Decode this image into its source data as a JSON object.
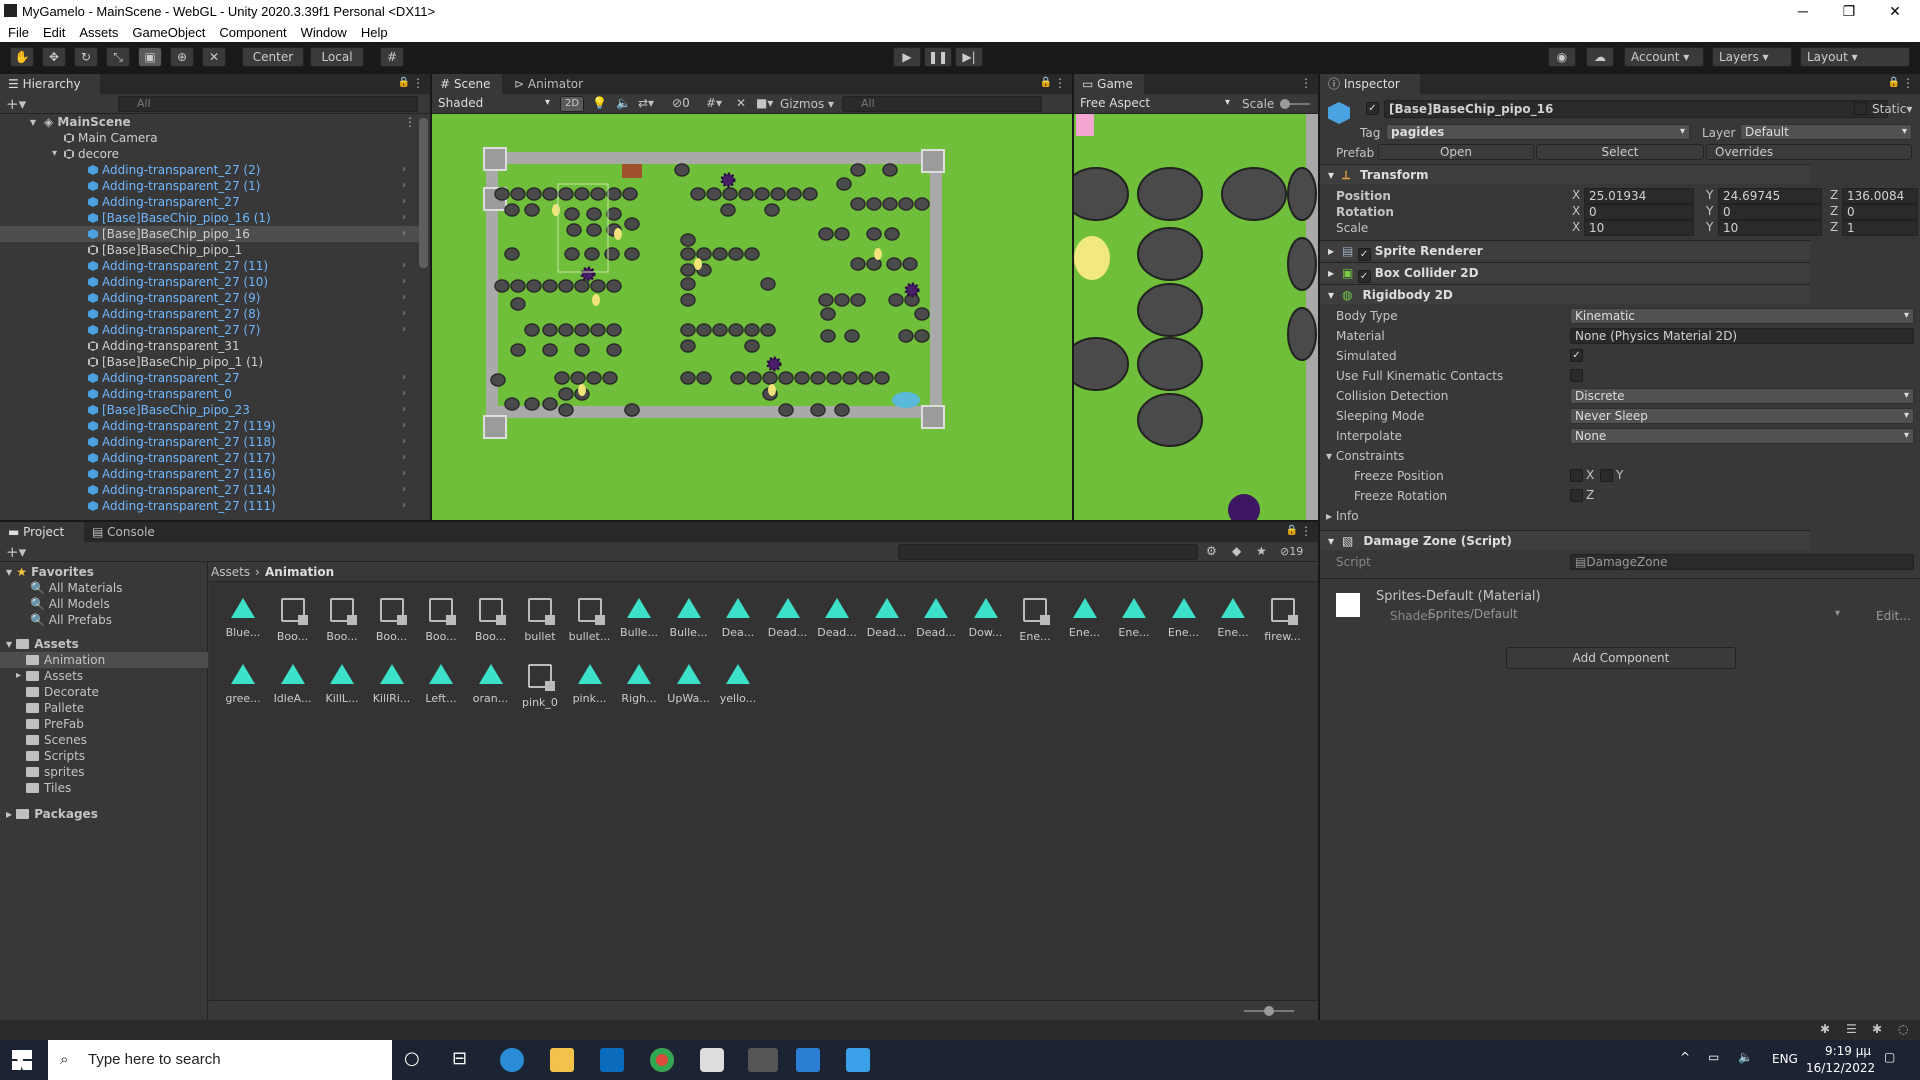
{
  "window": {
    "title": "MyGamelo - MainScene - WebGL - Unity 2020.3.39f1 Personal <DX11>",
    "min": "─",
    "max": "❐",
    "close": "✕"
  },
  "menu": [
    "File",
    "Edit",
    "Assets",
    "GameObject",
    "Component",
    "Window",
    "Help"
  ],
  "toolbar": {
    "pivot": "Center",
    "space": "Local",
    "account": "Account",
    "layers": "Layers",
    "layout": "Layout"
  },
  "hierarchy": {
    "tab": "Hierarchy",
    "search_placeholder": "All",
    "rows": [
      {
        "label": "MainScene",
        "icon": "scene",
        "indent": 0,
        "blue": false,
        "sel": false,
        "arrow": false
      },
      {
        "label": "Main Camera",
        "icon": "grey",
        "indent": 1,
        "blue": false,
        "sel": false,
        "arrow": false
      },
      {
        "label": "decore",
        "icon": "grey",
        "indent": 1,
        "blue": false,
        "sel": false,
        "arrow": false
      },
      {
        "label": "Adding-transparent_27 (2)",
        "icon": "blue",
        "indent": 2,
        "blue": true,
        "sel": false,
        "arrow": true
      },
      {
        "label": "Adding-transparent_27 (1)",
        "icon": "blue",
        "indent": 2,
        "blue": true,
        "sel": false,
        "arrow": true
      },
      {
        "label": "Adding-transparent_27",
        "icon": "blue",
        "indent": 2,
        "blue": true,
        "sel": false,
        "arrow": true
      },
      {
        "label": "[Base]BaseChip_pipo_16 (1)",
        "icon": "blue",
        "indent": 2,
        "blue": true,
        "sel": false,
        "arrow": true
      },
      {
        "label": "[Base]BaseChip_pipo_16",
        "icon": "blue",
        "indent": 2,
        "blue": false,
        "sel": true,
        "arrow": true
      },
      {
        "label": "[Base]BaseChip_pipo_1",
        "icon": "grey",
        "indent": 2,
        "blue": false,
        "sel": false,
        "arrow": false
      },
      {
        "label": "Adding-transparent_27 (11)",
        "icon": "blue",
        "indent": 2,
        "blue": true,
        "sel": false,
        "arrow": true
      },
      {
        "label": "Adding-transparent_27 (10)",
        "icon": "blue",
        "indent": 2,
        "blue": true,
        "sel": false,
        "arrow": true
      },
      {
        "label": "Adding-transparent_27 (9)",
        "icon": "blue",
        "indent": 2,
        "blue": true,
        "sel": false,
        "arrow": true
      },
      {
        "label": "Adding-transparent_27 (8)",
        "icon": "blue",
        "indent": 2,
        "blue": true,
        "sel": false,
        "arrow": true
      },
      {
        "label": "Adding-transparent_27 (7)",
        "icon": "blue",
        "indent": 2,
        "blue": true,
        "sel": false,
        "arrow": true
      },
      {
        "label": "Adding-transparent_31",
        "icon": "grey",
        "indent": 2,
        "blue": false,
        "sel": false,
        "arrow": false
      },
      {
        "label": "[Base]BaseChip_pipo_1 (1)",
        "icon": "grey",
        "indent": 2,
        "blue": false,
        "sel": false,
        "arrow": false
      },
      {
        "label": "Adding-transparent_27",
        "icon": "blue",
        "indent": 2,
        "blue": true,
        "sel": false,
        "arrow": true
      },
      {
        "label": "Adding-transparent_0",
        "icon": "blue",
        "indent": 2,
        "blue": true,
        "sel": false,
        "arrow": true
      },
      {
        "label": "[Base]BaseChip_pipo_23",
        "icon": "blue",
        "indent": 2,
        "blue": true,
        "sel": false,
        "arrow": true
      },
      {
        "label": "Adding-transparent_27 (119)",
        "icon": "blue",
        "indent": 2,
        "blue": true,
        "sel": false,
        "arrow": true
      },
      {
        "label": "Adding-transparent_27 (118)",
        "icon": "blue",
        "indent": 2,
        "blue": true,
        "sel": false,
        "arrow": true
      },
      {
        "label": "Adding-transparent_27 (117)",
        "icon": "blue",
        "indent": 2,
        "blue": true,
        "sel": false,
        "arrow": true
      },
      {
        "label": "Adding-transparent_27 (116)",
        "icon": "blue",
        "indent": 2,
        "blue": true,
        "sel": false,
        "arrow": true
      },
      {
        "label": "Adding-transparent_27 (114)",
        "icon": "blue",
        "indent": 2,
        "blue": true,
        "sel": false,
        "arrow": true
      },
      {
        "label": "Adding-transparent_27 (111)",
        "icon": "blue",
        "indent": 2,
        "blue": true,
        "sel": false,
        "arrow": true
      }
    ]
  },
  "scene": {
    "tab_scene": "Scene",
    "tab_animator": "Animator",
    "shading": "Shaded",
    "mode2d": "2D",
    "hidden_count": "0",
    "gizmos": "Gizmos",
    "search_placeholder": "All"
  },
  "game": {
    "tab": "Game",
    "aspect": "Free Aspect",
    "scale_label": "Scale"
  },
  "project": {
    "tab_project": "Project",
    "tab_console": "Console",
    "badge": "19",
    "breadcrumb": [
      "Assets",
      "Animation"
    ],
    "favorites": {
      "label": "Favorites",
      "items": [
        "All Materials",
        "All Models",
        "All Prefabs"
      ]
    },
    "assets_root": "Assets",
    "folders": [
      "Animation",
      "Assets",
      "Decorate",
      "Pallete",
      "PreFab",
      "Scenes",
      "Scripts",
      "sprites",
      "Tiles"
    ],
    "packages": "Packages",
    "row1": [
      {
        "label": "Blue...",
        "kind": "anim"
      },
      {
        "label": "Boo...",
        "kind": "ctrl"
      },
      {
        "label": "Boo...",
        "kind": "ctrl"
      },
      {
        "label": "Boo...",
        "kind": "ctrl"
      },
      {
        "label": "Boo...",
        "kind": "ctrl"
      },
      {
        "label": "Boo...",
        "kind": "ctrl"
      },
      {
        "label": "bullet",
        "kind": "ctrl"
      },
      {
        "label": "bullet...",
        "kind": "ctrl"
      },
      {
        "label": "Bulle...",
        "kind": "anim"
      },
      {
        "label": "Bulle...",
        "kind": "anim"
      },
      {
        "label": "Dea...",
        "kind": "anim"
      },
      {
        "label": "Dead...",
        "kind": "anim"
      },
      {
        "label": "Dead...",
        "kind": "anim"
      },
      {
        "label": "Dead...",
        "kind": "anim"
      },
      {
        "label": "Dead...",
        "kind": "anim"
      },
      {
        "label": "Dow...",
        "kind": "anim"
      },
      {
        "label": "Ene...",
        "kind": "ctrl"
      },
      {
        "label": "Ene...",
        "kind": "anim"
      },
      {
        "label": "Ene...",
        "kind": "anim"
      },
      {
        "label": "Ene...",
        "kind": "anim"
      },
      {
        "label": "Ene...",
        "kind": "anim"
      },
      {
        "label": "firew...",
        "kind": "ctrl"
      }
    ],
    "row2": [
      {
        "label": "gree...",
        "kind": "anim"
      },
      {
        "label": "IdleA...",
        "kind": "anim"
      },
      {
        "label": "KillL...",
        "kind": "anim"
      },
      {
        "label": "KillRi...",
        "kind": "anim"
      },
      {
        "label": "Left...",
        "kind": "anim"
      },
      {
        "label": "oran...",
        "kind": "anim"
      },
      {
        "label": "pink_0",
        "kind": "ctrl"
      },
      {
        "label": "pink...",
        "kind": "anim"
      },
      {
        "label": "Righ...",
        "kind": "anim"
      },
      {
        "label": "UpWa...",
        "kind": "anim"
      },
      {
        "label": "yello...",
        "kind": "anim"
      }
    ]
  },
  "inspector": {
    "tab": "Inspector",
    "object_name": "[Base]BaseChip_pipo_16",
    "static_label": "Static",
    "tag_label": "Tag",
    "tag_value": "pagides",
    "layer_label": "Layer",
    "layer_value": "Default",
    "prefab_label": "Prefab",
    "prefab_open": "Open",
    "prefab_select": "Select",
    "prefab_overrides": "Overrides",
    "transform": {
      "title": "Transform",
      "position_label": "Position",
      "position": {
        "x": "25.01934",
        "y": "24.69745",
        "z": "136.0084"
      },
      "rotation_label": "Rotation",
      "rotation": {
        "x": "0",
        "y": "0",
        "z": "0"
      },
      "scale_label": "Scale",
      "scale": {
        "x": "10",
        "y": "10",
        "z": "1"
      }
    },
    "sprite_renderer": "Sprite Renderer",
    "box_collider": "Box Collider 2D",
    "rigidbody": {
      "title": "Rigidbody 2D",
      "body_type_label": "Body Type",
      "body_type": "Kinematic",
      "material_label": "Material",
      "material": "None (Physics Material 2D)",
      "simulated_label": "Simulated",
      "kinematic_contacts_label": "Use Full Kinematic Contacts",
      "collision_label": "Collision Detection",
      "collision": "Discrete",
      "sleeping_label": "Sleeping Mode",
      "sleeping": "Never Sleep",
      "interpolate_label": "Interpolate",
      "interpolate": "None",
      "constraints_label": "Constraints",
      "freeze_pos_label": "Freeze Position",
      "freeze_rot_label": "Freeze Rotation",
      "info_label": "Info"
    },
    "damage_zone": {
      "title": "Damage Zone (Script)",
      "script_label": "Script",
      "script_value": "DamageZone"
    },
    "material": {
      "title": "Sprites-Default (Material)",
      "shader_label": "Shader",
      "shader_value": "Sprites/Default",
      "edit": "Edit..."
    },
    "add_component": "Add Component"
  },
  "taskbar": {
    "search_placeholder": "Type here to search",
    "lang": "ENG",
    "time": "9:19 μμ",
    "date": "16/12/2022"
  }
}
